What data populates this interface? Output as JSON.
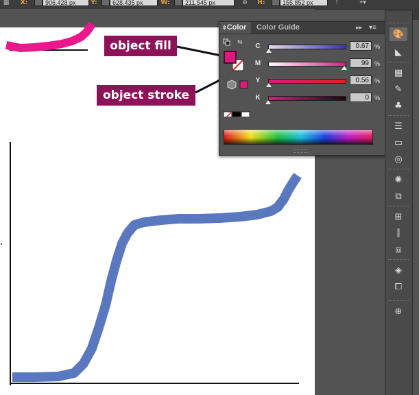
{
  "control_bar": {
    "x_value": "906.428 px",
    "y_value": "628.435 px",
    "w_value": "211.545 px",
    "h_value": "155.852 px",
    "x_label": "X:",
    "y_label": "Y:",
    "w_label": "W:",
    "h_label": "H:"
  },
  "callouts": {
    "fill_label": "object fill",
    "stroke_label": "object stroke"
  },
  "color_panel": {
    "tabs": [
      "Color",
      "Color Guide"
    ],
    "channels": [
      {
        "label": "C",
        "value": "0.67",
        "fraction": 0.0067
      },
      {
        "label": "M",
        "value": "99",
        "fraction": 0.99
      },
      {
        "label": "Y",
        "value": "0.56",
        "fraction": 0.0056
      },
      {
        "label": "K",
        "value": "0",
        "fraction": 0
      }
    ],
    "percent_sign": "%",
    "fill_color": "#e0187e",
    "panel_arrows": "▸▸",
    "menu_icon": "▾≡"
  },
  "colors": {
    "pink_stroke": "#ec168d",
    "blue_stroke": "#5a78c0",
    "callout_bg": "#8e1257"
  },
  "toolbar": {
    "icons": [
      "color-palette-icon",
      "color-guide-icon",
      "swatches-icon",
      "brushes-icon",
      "symbols-icon",
      "stroke-icon",
      "gradient-icon",
      "transparency-icon",
      "appearance-icon",
      "graphic-styles-icon",
      "align-icon",
      "transform-icon",
      "pathfinder-icon",
      "layers-icon",
      "artboards-icon",
      "navigator-icon"
    ]
  }
}
